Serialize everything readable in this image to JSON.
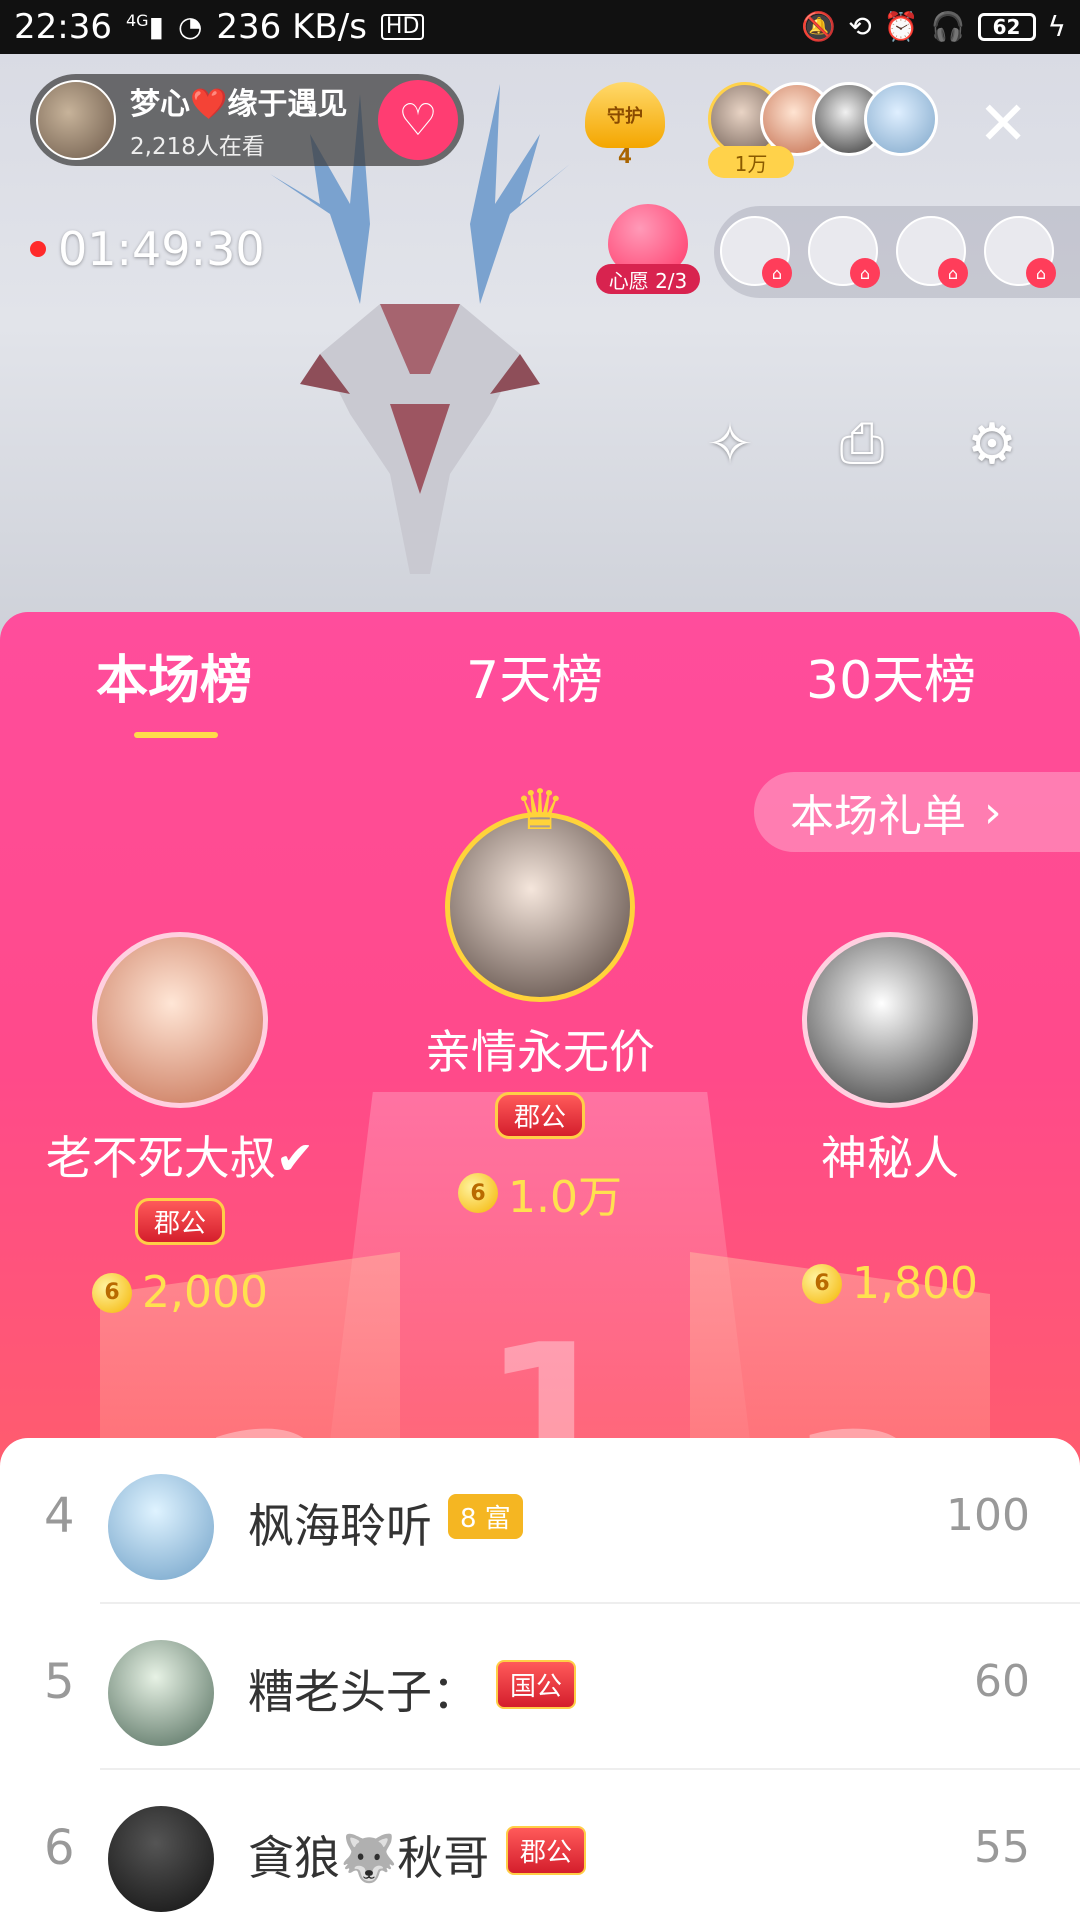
{
  "status_bar": {
    "time": "22:36",
    "network": "4G",
    "speed": "236 KB/s",
    "hd": "HD",
    "battery": "62"
  },
  "live": {
    "host_name": "梦心❤️缘于遇见",
    "viewers": "2,218人在看",
    "guard_label": "守护",
    "guard_count": "4",
    "top_badge": "1万",
    "timer": "01:49:30",
    "wish_label": "心愿 2/3"
  },
  "panel": {
    "tabs": [
      "本场榜",
      "7天榜",
      "30天榜"
    ],
    "active_tab_index": 0,
    "gift_list_label": "本场礼单",
    "winners": [
      {
        "rank": 1,
        "name": "亲情永无价",
        "badge": "郡公",
        "coins": "1.0万"
      },
      {
        "rank": 2,
        "name": "老不死大叔✔",
        "badge": "郡公",
        "coins": "2,000"
      },
      {
        "rank": 3,
        "name": "神秘人",
        "coins": "1,800"
      }
    ],
    "podium_numbers": [
      "1",
      "2",
      "3"
    ]
  },
  "list": [
    {
      "rank": "4",
      "name": "枫海聆听",
      "tag": "8 富",
      "value": "100"
    },
    {
      "rank": "5",
      "name": "糟老头子：",
      "tag": "国公",
      "value": "60"
    },
    {
      "rank": "6",
      "name": "貪狼🐺秋哥",
      "tag": "郡公",
      "value": "55"
    }
  ],
  "colors": {
    "panel_top": "#ff4d9c",
    "panel_bottom": "#ff8c6b",
    "coin_text": "#ffe14f",
    "follow_button": "#ff3d72",
    "tab_underline": "#ffdc4a"
  }
}
